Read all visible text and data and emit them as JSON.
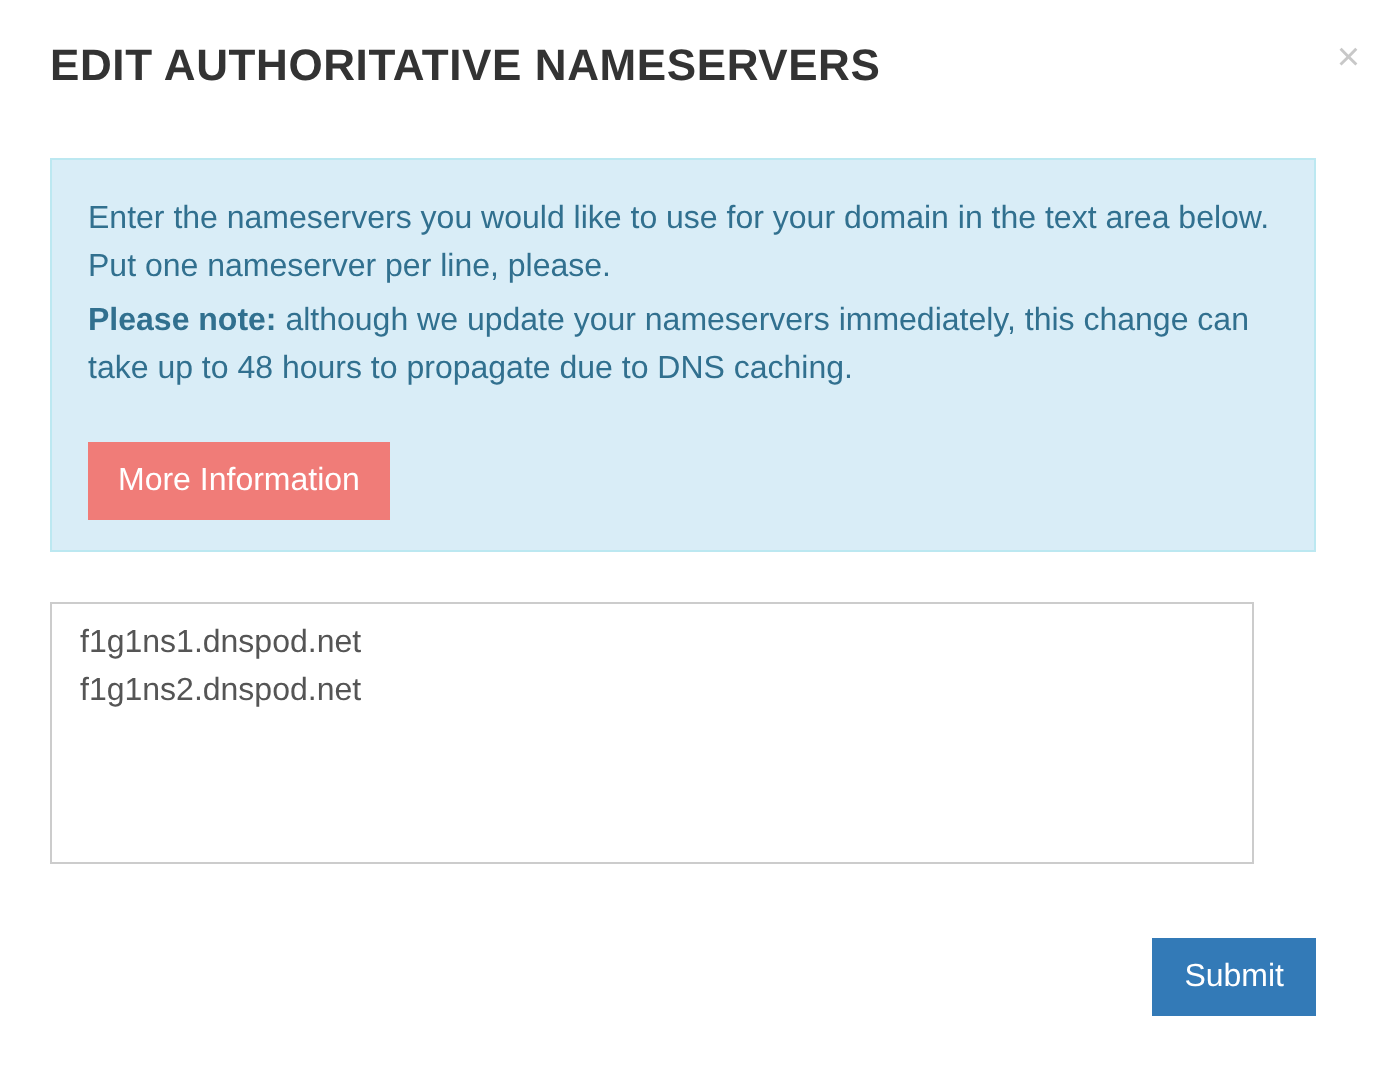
{
  "dialog": {
    "title": "EDIT AUTHORITATIVE NAMESERVERS",
    "close": "×"
  },
  "info": {
    "paragraphs": [
      "Enter the nameservers you would like to use for your domain in the text area below. Put one nameserver per line, please.",
      "**Please note:** although we update your nameservers immediately, this change can take up to 48 hours to propagate due to DNS caching."
    ],
    "button": "More Information"
  },
  "nameservers_field": {
    "value": "f1g1ns1.dnspod.net\nf1g1ns2.dnspod.net"
  },
  "buttons": [
    "Submit"
  ]
}
